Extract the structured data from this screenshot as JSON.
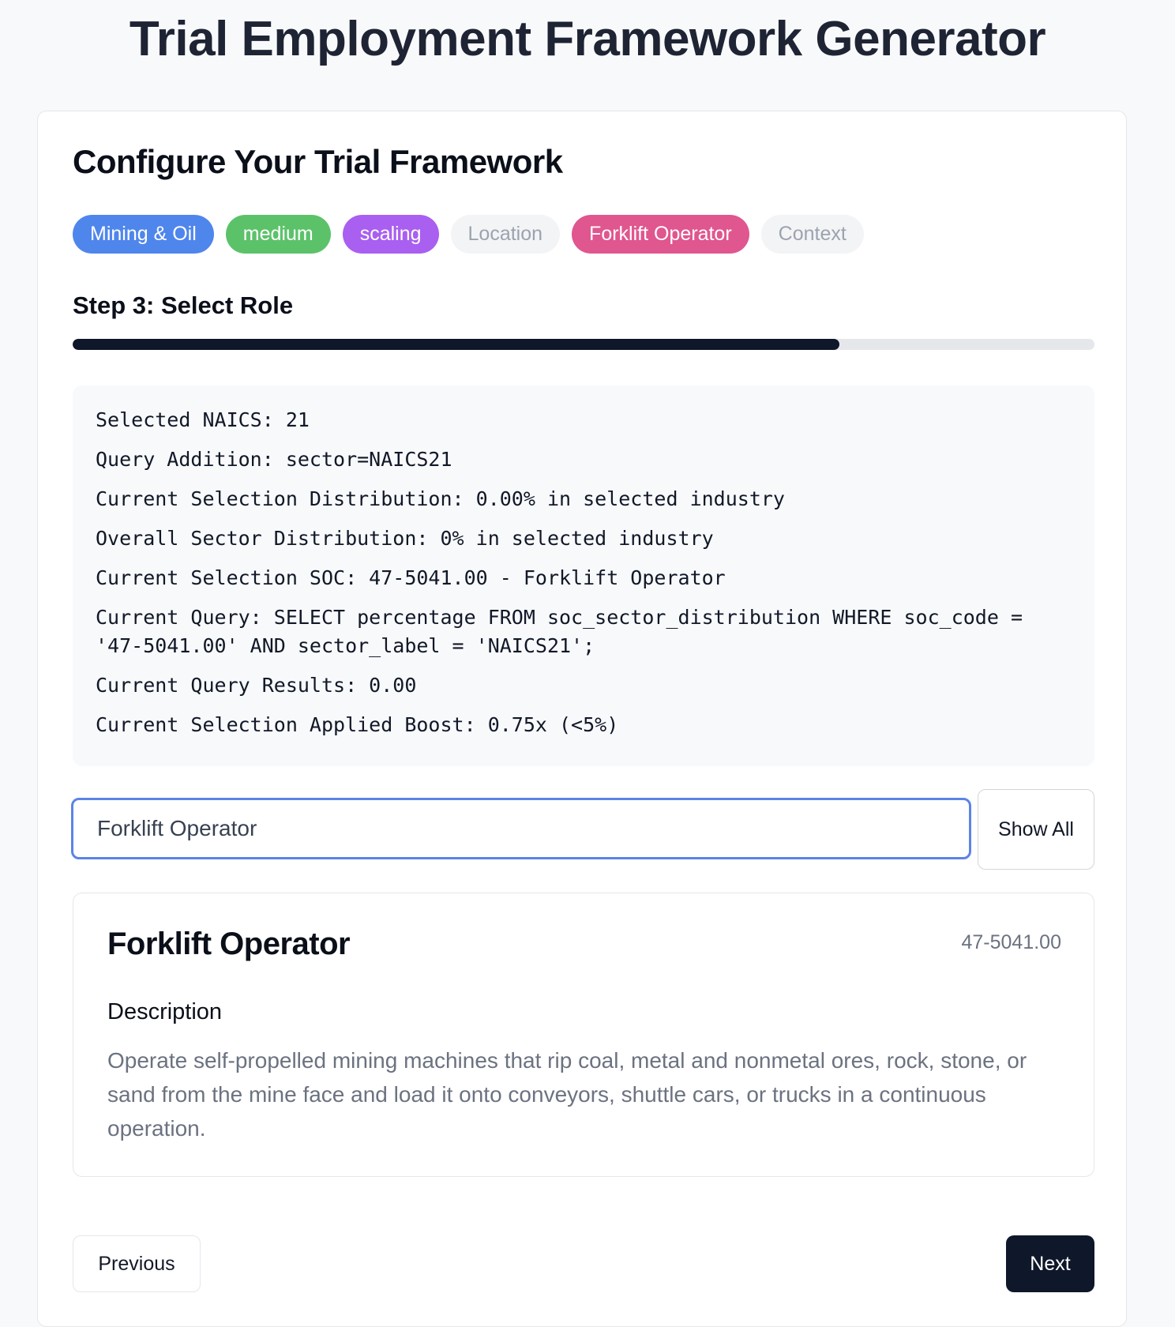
{
  "page": {
    "title": "Trial Employment Framework Generator"
  },
  "card": {
    "title": "Configure Your Trial Framework",
    "chips": [
      {
        "label": "Mining & Oil",
        "color": "#4f86ec",
        "state": "selected"
      },
      {
        "label": "medium",
        "color": "#5cc26a",
        "state": "selected"
      },
      {
        "label": "scaling",
        "color": "#a95ff0",
        "state": "selected"
      },
      {
        "label": "Location",
        "color": "#f3f4f6",
        "state": "empty"
      },
      {
        "label": "Forklift Operator",
        "color": "#e0568f",
        "state": "selected"
      },
      {
        "label": "Context",
        "color": "#f3f4f6",
        "state": "empty"
      }
    ],
    "step_label": "Step 3: Select Role",
    "progress": 0.75
  },
  "info": {
    "lines": [
      "Selected NAICS: 21",
      "Query Addition: sector=NAICS21",
      "Current Selection Distribution: 0.00% in selected industry",
      "Overall Sector Distribution: 0% in selected industry",
      "Current Selection SOC: 47-5041.00 - Forklift Operator",
      "Current Query: SELECT percentage FROM soc_sector_distribution WHERE soc_code = '47-5041.00' AND sector_label = 'NAICS21';",
      "Current Query Results: 0.00",
      "Current Selection Applied Boost: 0.75x (<5%)"
    ]
  },
  "search": {
    "value": "Forklift Operator",
    "show_all_label": "Show All"
  },
  "role": {
    "title": "Forklift Operator",
    "code": "47-5041.00",
    "description_heading": "Description",
    "description": "Operate self-propelled mining machines that rip coal, metal and nonmetal ores, rock, stone, or sand from the mine face and load it onto conveyors, shuttle cars, or trucks in a continuous operation."
  },
  "nav": {
    "previous_label": "Previous",
    "next_label": "Next"
  }
}
